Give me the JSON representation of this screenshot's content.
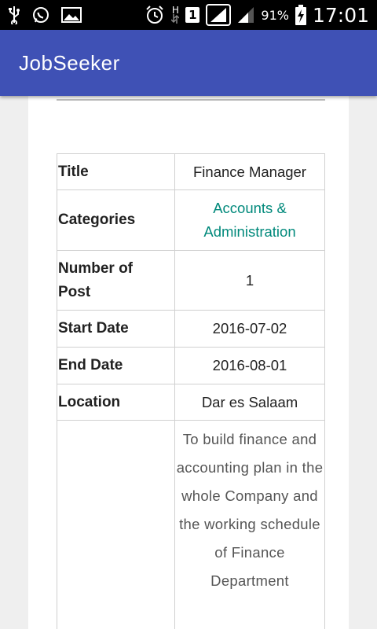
{
  "status_bar": {
    "icons": [
      "usb-icon",
      "whatsapp-icon",
      "image-icon",
      "alarm-icon",
      "hsdpa-icon",
      "sim-1-icon",
      "signal-full-icon",
      "signal-partial-icon",
      "battery-charging-icon"
    ],
    "network": "H",
    "sim": "1",
    "battery": "91%",
    "time": "17:01"
  },
  "app_bar": {
    "title": "JobSeeker",
    "color": "#3f51b5"
  },
  "job": {
    "rows": [
      {
        "label": "Title",
        "value": "Finance Manager"
      },
      {
        "label": "Categories",
        "value": "Accounts & Administration"
      },
      {
        "label": "Number of Post",
        "value": "1"
      },
      {
        "label": "Start Date",
        "value": "2016-07-02"
      },
      {
        "label": "End Date",
        "value": "2016-08-01"
      },
      {
        "label": "Location",
        "value": "Dar es Salaam"
      },
      {
        "label": "",
        "value": "To build finance and accounting plan in the whole Company and the working schedule of Finance Department"
      }
    ],
    "link_color": "#00897b"
  }
}
